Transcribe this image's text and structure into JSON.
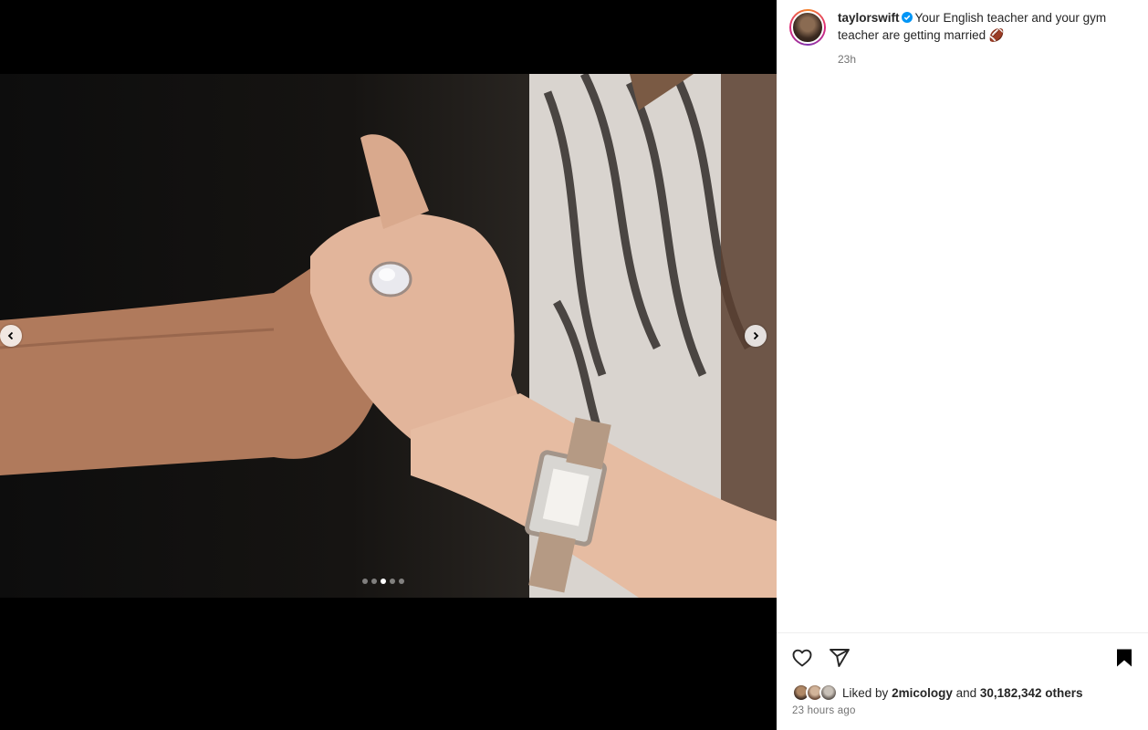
{
  "post": {
    "username": "taylorswift",
    "caption": "Your English teacher and your gym teacher are getting married",
    "caption_emoji": "🏈",
    "time_short": "23h",
    "time_full": "23 hours ago"
  },
  "carousel": {
    "slide_count": 5,
    "active_index": 2
  },
  "icons": {
    "verified": "verified-badge-icon",
    "like": "heart-icon",
    "share": "paper-plane-icon",
    "save": "bookmark-icon",
    "prev": "chevron-left-icon",
    "next": "chevron-right-icon"
  },
  "likes": {
    "prefix": "Liked by",
    "user": "2micology",
    "middle": "and",
    "count_text": "30,182,342 others"
  },
  "colors": {
    "verified_blue": "#0095f6",
    "text": "#262626",
    "muted": "#737373"
  }
}
